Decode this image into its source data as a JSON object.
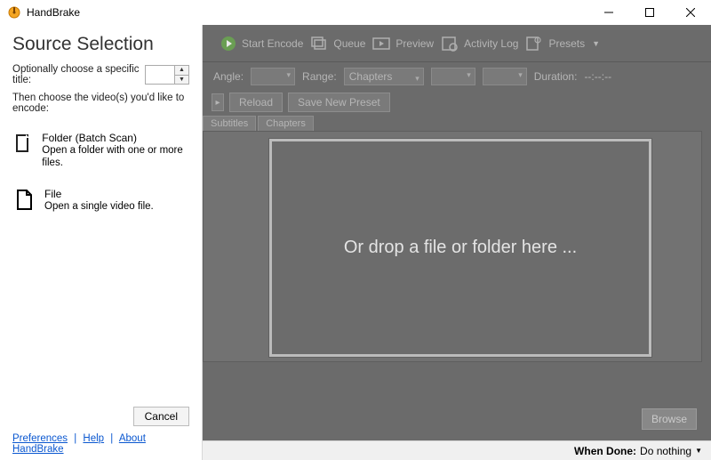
{
  "window": {
    "title": "HandBrake"
  },
  "toolbar": {
    "start_encode": "Start Encode",
    "queue": "Queue",
    "preview": "Preview",
    "activity_log": "Activity Log",
    "presets": "Presets"
  },
  "subbar": {
    "angle_label": "Angle:",
    "range_label": "Range:",
    "range_mode": "Chapters",
    "duration_label": "Duration:",
    "duration_value": "--:--:--"
  },
  "preset_actions": {
    "reload": "Reload",
    "save_new": "Save New Preset"
  },
  "tabs": {
    "subtitles": "Subtitles",
    "chapters": "Chapters"
  },
  "browse_label": "Browse",
  "dropzone_text": "Or drop a file or folder here ...",
  "statusbar": {
    "when_done_label": "When Done:",
    "when_done_value": "Do nothing"
  },
  "panel": {
    "heading": "Source Selection",
    "specific_title_label": "Optionally choose a specific title:",
    "specific_title_value": "",
    "hint": "Then choose the video(s) you'd like to encode:",
    "folder_title": "Folder (Batch Scan)",
    "folder_desc": "Open a folder with one or more files.",
    "file_title": "File",
    "file_desc": "Open a single video file.",
    "cancel": "Cancel",
    "links": {
      "preferences": "Preferences",
      "help": "Help",
      "about": "About HandBrake"
    }
  }
}
